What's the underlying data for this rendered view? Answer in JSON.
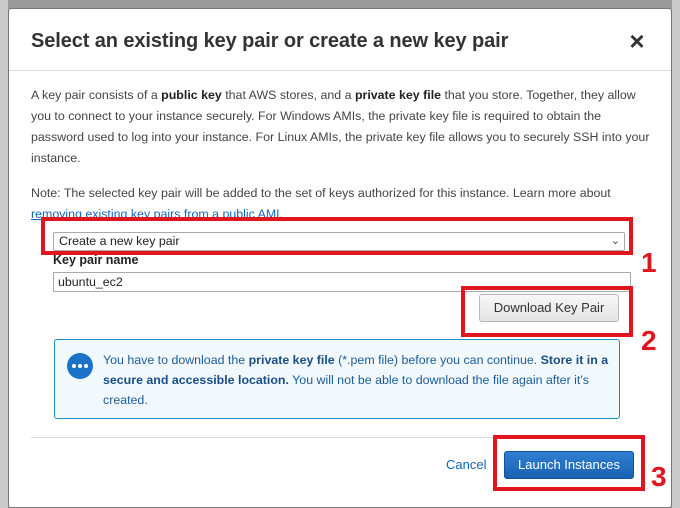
{
  "dialog": {
    "title": "Select an existing key pair or create a new key pair",
    "close_glyph": "×",
    "intro": {
      "p1": "A key pair consists of a ",
      "b1": "public key",
      "p2": " that AWS stores, and a ",
      "b2": "private key file",
      "p3": " that you store. Together, they allow you to connect to your instance securely. For Windows AMIs, the private key file is required to obtain the password used to log into your instance. For Linux AMIs, the private key file allows you to securely SSH into your instance."
    },
    "note": {
      "text": "Note: The selected key pair will be added to the set of keys authorized for this instance. Learn more about ",
      "link": "removing existing key pairs from a public AMI",
      "end": "."
    },
    "key_pair_select": {
      "selected": "Create a new key pair",
      "chevron": "⌄"
    },
    "key_pair_name": {
      "label": "Key pair name",
      "value": "ubuntu_ec2"
    },
    "download_button": "Download Key Pair",
    "info": {
      "t1": "You have to download the ",
      "b1": "private key file",
      "t2": " (*.pem file) before you can continue. ",
      "b2": "Store it in a secure and accessible location.",
      "t3": " You will not be able to download the file again after it's created."
    },
    "cancel_label": "Cancel",
    "launch_button": "Launch Instances"
  },
  "annotations": [
    "1",
    "2",
    "3"
  ],
  "colors": {
    "annotation": "#e2141e",
    "primary": "#1a62b3",
    "link": "#1166bb",
    "info_border": "#1f8ccc"
  }
}
